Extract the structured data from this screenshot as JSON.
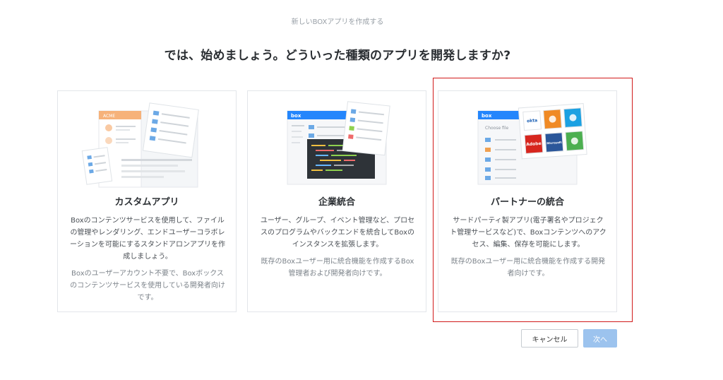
{
  "header": {
    "title": "新しいBOXアプリを作成する"
  },
  "question": "では、始めましょう。どういった種類のアプリを開発しますか?",
  "cards": [
    {
      "title": "カスタムアプリ",
      "description": "Boxのコンテンツサービスを使用して、ファイルの管理やレンダリング、エンドユーザーコラボレーションを可能にするスタンドアロンアプリを作成しましょう。",
      "note": "Boxのユーザーアカウント不要で、Boxボックスのコンテンツサービスを使用している開発者向けです。",
      "illustration": {
        "header_label": "ACME",
        "accent": "#f6b27a"
      }
    },
    {
      "title": "企業統合",
      "description": "ユーザー、グループ、イベント管理など、プロセスのプログラムやバックエンドを統合してBoxのインスタンスを拡張します。",
      "note": "既存のBoxユーザー用に統合機能を作成するBox管理者および開発者向けです。",
      "illustration": {
        "header_label": "box",
        "accent": "#2486fc"
      }
    },
    {
      "title": "パートナーの統合",
      "description": "サードパーティ製アプリ(電子署名やプロジェクト管理サービスなど)で、Boxコンテンツへのアクセス、編集、保存を可能にします。",
      "note": "既存のBoxユーザー用に統合機能を作成する開発者向けです。",
      "illustration": {
        "header_label": "box",
        "sub_label": "Choose file",
        "tiles": [
          {
            "label": "okta",
            "color": "#ffffff",
            "text": "#1a5fb4"
          },
          {
            "label": "",
            "color": "#f08a24",
            "text": "#ffffff"
          },
          {
            "label": "",
            "color": "#1ba1e2",
            "text": "#ffffff"
          },
          {
            "label": "Adobe",
            "color": "#d7261e",
            "text": "#ffffff"
          },
          {
            "label": "Microsoft",
            "color": "#2b579a",
            "text": "#ffffff"
          },
          {
            "label": "",
            "color": "#4caf50",
            "text": "#ffffff"
          }
        ]
      }
    }
  ],
  "buttons": {
    "cancel": "キャンセル",
    "next": "次へ"
  },
  "colors": {
    "selection_frame": "#d11a1a",
    "primary_disabled": "#9cc3ee",
    "box_blue": "#2486fc"
  }
}
